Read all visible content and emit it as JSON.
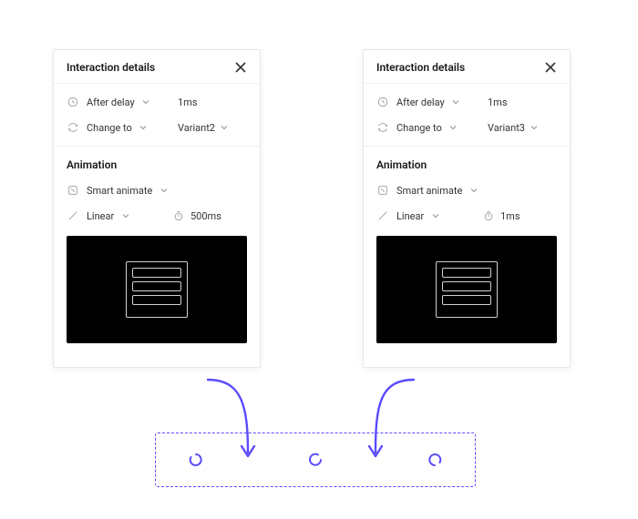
{
  "panels": [
    {
      "title": "Interaction details",
      "trigger_label": "After delay",
      "trigger_value": "1ms",
      "action_label": "Change to",
      "action_value": "Variant2",
      "animation_heading": "Animation",
      "animation_type": "Smart animate",
      "easing": "Linear",
      "duration": "500ms"
    },
    {
      "title": "Interaction details",
      "trigger_label": "After delay",
      "trigger_value": "1ms",
      "action_label": "Change to",
      "action_value": "Variant3",
      "animation_heading": "Animation",
      "animation_type": "Smart animate",
      "easing": "Linear",
      "duration": "1ms"
    }
  ]
}
